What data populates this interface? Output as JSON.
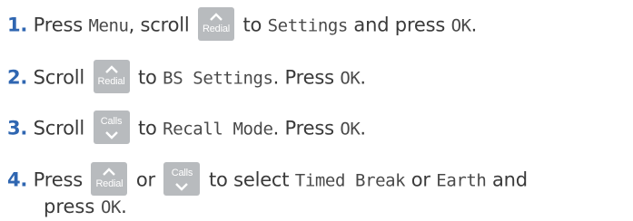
{
  "steps": [
    {
      "number": "1",
      "dot": ".",
      "t1": " Press ",
      "lcd1": "Menu",
      "t2": ", scroll ",
      "key1": "Redial",
      "t3": " to ",
      "lcd2": "Settings",
      "t4": " and press ",
      "lcd3": "OK",
      "t5": "."
    },
    {
      "number": "2",
      "dot": ".",
      "t1": " Scroll ",
      "key1": "Redial",
      "t2": " to ",
      "lcd1": "BS Settings",
      "t3": ". Press ",
      "lcd2": "OK",
      "t4": "."
    },
    {
      "number": "3",
      "dot": ".",
      "t1": " Scroll ",
      "key1": "Calls",
      "t2": " to ",
      "lcd1": "Recall Mode",
      "t3": ". Press ",
      "lcd2": "OK",
      "t4": "."
    },
    {
      "number": "4",
      "dot": ".",
      "t1": " Press ",
      "key1": "Redial",
      "t2": " or ",
      "key2": "Calls",
      "t3": " to select ",
      "lcd1": "Timed Break",
      "t4": " or ",
      "lcd2": "Earth",
      "t5": " and",
      "cont1": "press ",
      "lcd3": "OK",
      "cont2": "."
    }
  ],
  "colors": {
    "step_number": "#2f66b1",
    "text": "#3a3a3a",
    "key_background": "#b8bbbe",
    "key_text": "#ffffff"
  },
  "icons": {
    "redial_key": "chevron-up-icon",
    "calls_key": "chevron-down-icon"
  }
}
